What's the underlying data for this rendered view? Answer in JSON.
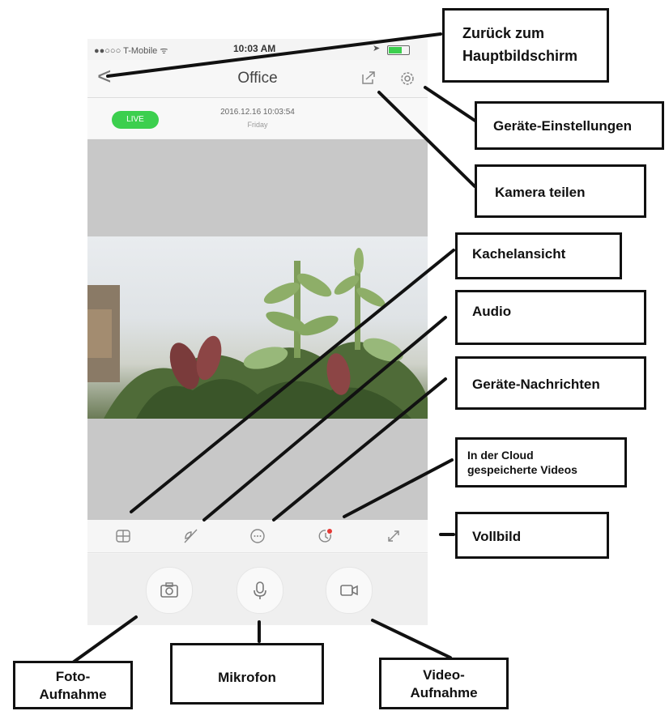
{
  "status_bar": {
    "carrier": "●●○○○ T-Mobile ᯤ",
    "time": "10:03 AM"
  },
  "nav": {
    "back_glyph": "<",
    "title": "Office"
  },
  "info": {
    "live_label": "LIVE",
    "datetime": "2016.12.16  10:03:54",
    "weekday": "Friday"
  },
  "callouts": {
    "back": [
      "Zurück zum",
      "Hauptbildschirm"
    ],
    "settings": "Geräte-Einstellungen",
    "share": "Kamera teilen",
    "tile_view": "Kachelansicht",
    "audio": "Audio",
    "messages": "Geräte-Nachrichten",
    "cloud": [
      "In der Cloud",
      "gespeicherte Videos"
    ],
    "fullscreen": "Vollbild",
    "photo": [
      "Foto-",
      "Aufnahme"
    ],
    "mic": "Mikrofon",
    "video": [
      "Video-",
      "Aufnahme"
    ]
  },
  "colors": {
    "live_green": "#3ccf4e",
    "cloud_dot": "#e53935"
  }
}
